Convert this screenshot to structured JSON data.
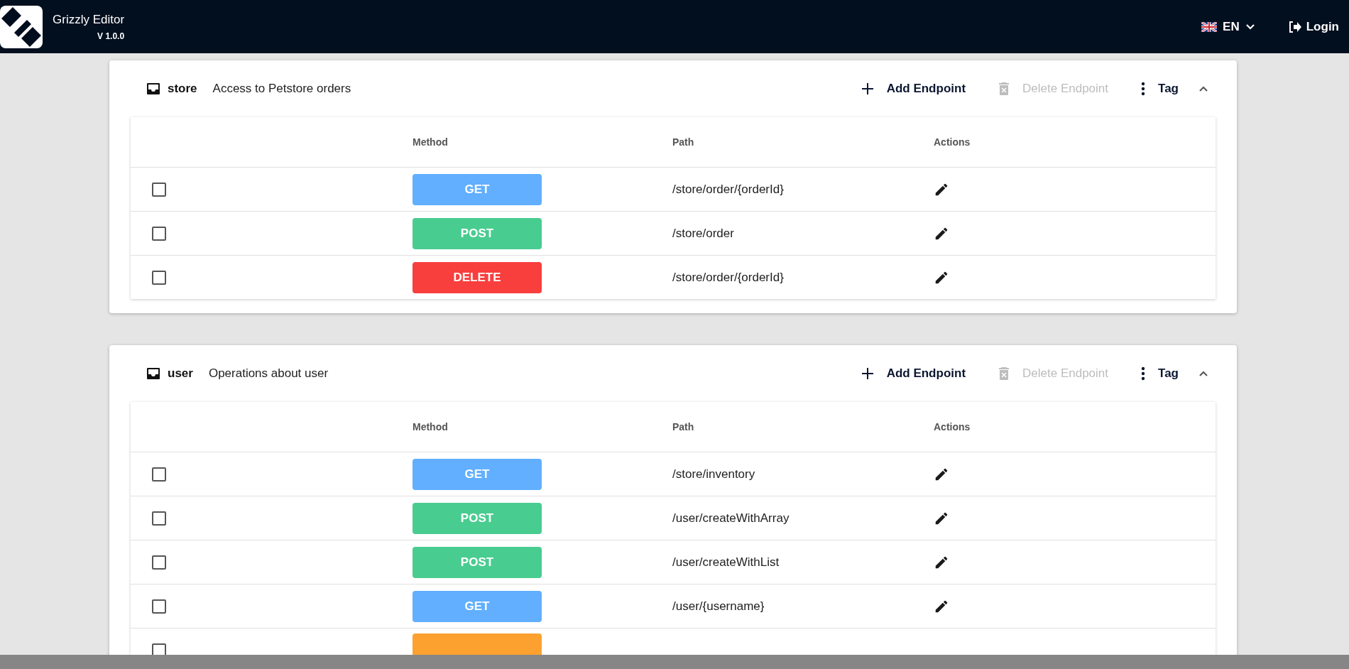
{
  "header": {
    "title": "Grizzly Editor",
    "version": "V 1.0.0",
    "language": "EN",
    "login": "Login"
  },
  "tags": [
    {
      "name": "store",
      "description": "Access to Petstore orders",
      "add_label": "Add Endpoint",
      "delete_label": "Delete Endpoint",
      "delete_disabled": true,
      "tag_label": "Tag",
      "expanded": true,
      "columns": [
        "Method",
        "Path",
        "Actions"
      ],
      "rows": [
        {
          "checked": false,
          "method": "GET",
          "kind": "get",
          "path": "/store/order/{orderId}"
        },
        {
          "checked": false,
          "method": "POST",
          "kind": "post",
          "path": "/store/order"
        },
        {
          "checked": false,
          "method": "DELETE",
          "kind": "delete",
          "path": "/store/order/{orderId}"
        }
      ]
    },
    {
      "name": "user",
      "description": "Operations about user",
      "add_label": "Add Endpoint",
      "delete_label": "Delete Endpoint",
      "delete_disabled": true,
      "tag_label": "Tag",
      "expanded": true,
      "columns": [
        "Method",
        "Path",
        "Actions"
      ],
      "rows": [
        {
          "checked": false,
          "method": "GET",
          "kind": "get",
          "path": "/store/inventory"
        },
        {
          "checked": false,
          "method": "POST",
          "kind": "post",
          "path": "/user/createWithArray"
        },
        {
          "checked": false,
          "method": "POST",
          "kind": "post",
          "path": "/user/createWithList"
        },
        {
          "checked": false,
          "method": "GET",
          "kind": "get",
          "path": "/user/{username}"
        },
        {
          "checked": false,
          "kind": "put"
        }
      ]
    }
  ]
}
